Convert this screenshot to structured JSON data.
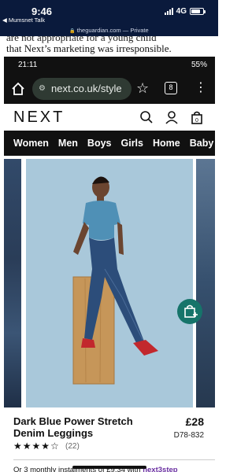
{
  "ios_status": {
    "time": "9:46",
    "network": "4G"
  },
  "ios_nav": {
    "back_label": "◀ Mumsnet Talk",
    "url": "theguardian.com",
    "mode": "— Private"
  },
  "article": {
    "clipped_line": "are not appropriate for a young child",
    "line": "that Next’s marketing was irresponsible."
  },
  "android_status": {
    "time": "21:11",
    "right": "55%"
  },
  "browser": {
    "url": "next.co.uk/style",
    "tab_count": "8"
  },
  "site": {
    "logo": "NEXT",
    "nav": [
      "Women",
      "Men",
      "Boys",
      "Girls",
      "Home",
      "Baby"
    ]
  },
  "carousel": {
    "dot_count": 6,
    "active_dot": 0
  },
  "product": {
    "name": "Dark Blue Power Stretch Denim Leggings",
    "price": "£28",
    "code": "D78-832",
    "stars": "★★★★☆",
    "rating_value": 4,
    "rating_count": "(22)",
    "instalments_text": "Or 3 monthly instalments of £9.34 with ",
    "instalments_brand": "next3step"
  },
  "colors": {
    "ios_bar": "#0a1a3c",
    "android_bar": "#111111",
    "omnibox": "#2f3a33",
    "photo_bg": "#a9c8da",
    "cart_button": "#16746a",
    "next3step": "#6a2fa1"
  },
  "icons": [
    "lock-icon",
    "signal-icon",
    "battery-icon",
    "home-icon",
    "tune-icon",
    "star-icon",
    "tabs-icon",
    "kebab-icon",
    "search-icon",
    "account-icon",
    "bag-icon",
    "add-to-bag-icon"
  ]
}
